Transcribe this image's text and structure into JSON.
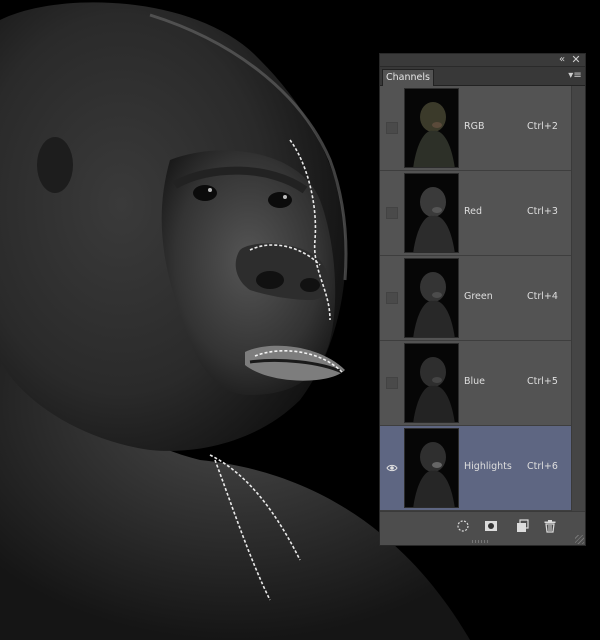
{
  "panel": {
    "tab_label": "Channels",
    "collapse_icon": "double-chevron-icon",
    "close_icon": "close-icon",
    "menu_icon": "panel-menu-icon"
  },
  "channels": [
    {
      "name": "RGB",
      "shortcut": "Ctrl+2",
      "visible": false,
      "selected": false
    },
    {
      "name": "Red",
      "shortcut": "Ctrl+3",
      "visible": false,
      "selected": false
    },
    {
      "name": "Green",
      "shortcut": "Ctrl+4",
      "visible": false,
      "selected": false
    },
    {
      "name": "Blue",
      "shortcut": "Ctrl+5",
      "visible": false,
      "selected": false
    },
    {
      "name": "Highlights",
      "shortcut": "Ctrl+6",
      "visible": true,
      "selected": true
    }
  ],
  "footer_tools": [
    {
      "icon": "load-selection-icon"
    },
    {
      "icon": "save-selection-mask-icon"
    },
    {
      "icon": "new-channel-icon"
    },
    {
      "icon": "trash-icon"
    }
  ],
  "colors": {
    "panel_bg": "#535353",
    "selected_row": "#5e6682",
    "canvas_bg": "#000000"
  }
}
